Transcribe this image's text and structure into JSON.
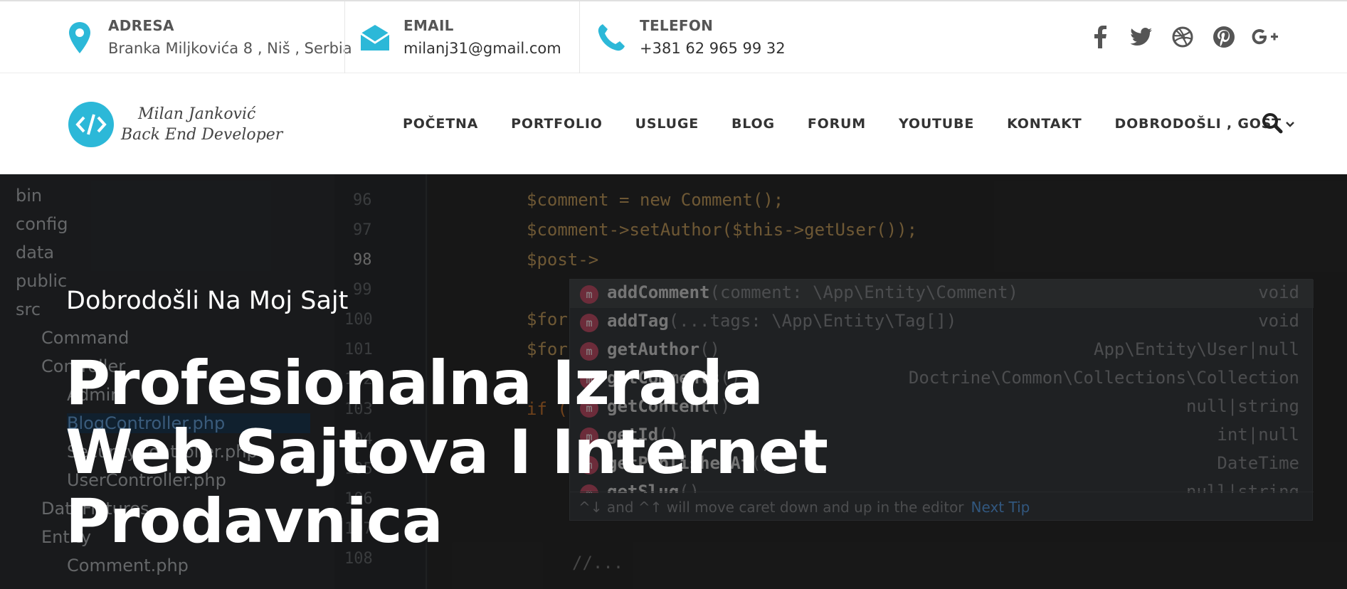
{
  "topbar": {
    "address": {
      "label": "ADRESA",
      "value": "Branka Miljkovića 8 , Niš , Serbia",
      "icon": "map-pin-icon"
    },
    "email": {
      "label": "EMAIL",
      "value": "milanj31@gmail.com",
      "icon": "envelope-icon"
    },
    "phone": {
      "label": "TELEFON",
      "value": "+381 62 965 99 32",
      "icon": "phone-icon"
    },
    "social": [
      "facebook-icon",
      "twitter-icon",
      "dribbble-icon",
      "pinterest-icon",
      "google-plus-icon"
    ],
    "accent_color": "#2cb8d8"
  },
  "logo": {
    "line1": "Milan Janković",
    "line2": "Back End Developer",
    "symbol": "</>"
  },
  "nav": {
    "items": [
      "POČETNA",
      "PORTFOLIO",
      "USLUGE",
      "BLOG",
      "FORUM",
      "YOUTUBE",
      "KONTAKT",
      "DOBRODOŠLI , GOST"
    ]
  },
  "hero": {
    "subtitle": "Dobrodošli Na Moj Sajt",
    "title_line1": "Profesionalna Izrada",
    "title_line2": "Web Sajtova I Internet",
    "title_line3": "Prodavnica",
    "ide": {
      "tree": [
        "bin",
        "config",
        "data",
        "public",
        "src",
        "Command",
        "Controller",
        "Admin",
        "BlogController.php",
        "SecurityController.php",
        "UserController.php",
        "DataFixtures",
        "Entity",
        "Comment.php"
      ],
      "line_numbers": [
        "96",
        "97",
        "98",
        "99",
        "100",
        "101",
        "102",
        "103",
        "104",
        "105",
        "106",
        "107",
        "108"
      ],
      "code": [
        "$comment = new Comment();",
        "$comment->setAuthor($this->getUser());",
        "$post->",
        "$for",
        "$for",
        "if (",
        "//..."
      ],
      "popup": [
        {
          "name": "addComment",
          "args": "(comment: \\App\\Entity\\Comment)",
          "type": "void"
        },
        {
          "name": "addTag",
          "args": "(...tags: \\App\\Entity\\Tag[])",
          "type": "void"
        },
        {
          "name": "getAuthor",
          "args": "()",
          "type": "App\\Entity\\User|null"
        },
        {
          "name": "getComments",
          "args": "()",
          "type": "Doctrine\\Common\\Collections\\Collection"
        },
        {
          "name": "getContent",
          "args": "()",
          "type": "null|string"
        },
        {
          "name": "getId",
          "args": "()",
          "type": "int|null"
        },
        {
          "name": "getPublishedAt",
          "args": "()",
          "type": "DateTime"
        },
        {
          "name": "getSlug",
          "args": "()",
          "type": "null|string"
        }
      ],
      "tip": "^↓ and ^↑ will move caret down and up in the editor",
      "tip_link": "Next Tip"
    }
  }
}
